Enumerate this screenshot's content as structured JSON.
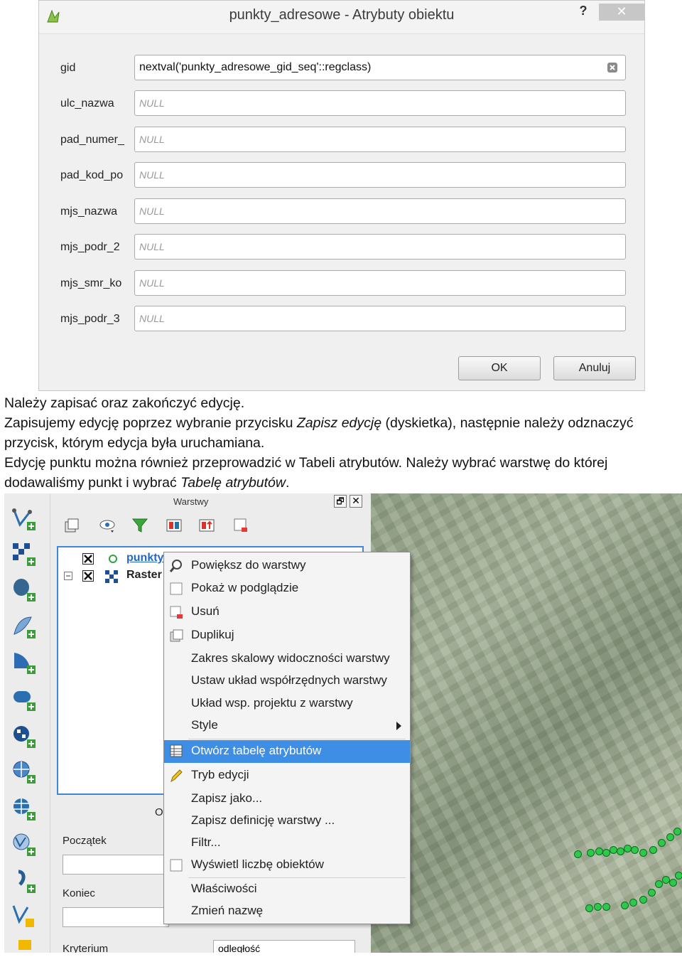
{
  "dialog": {
    "title": "punkty_adresowe - Atrybuty obiektu",
    "help": "?",
    "close": "✕",
    "fields": [
      {
        "label": "gid",
        "value": "nextval('punkty_adresowe_gid_seq'::regclass)"
      },
      {
        "label": "ulc_nazwa",
        "value": "NULL"
      },
      {
        "label": "pad_numer_",
        "value": "NULL"
      },
      {
        "label": "pad_kod_po",
        "value": "NULL"
      },
      {
        "label": "mjs_nazwa",
        "value": "NULL"
      },
      {
        "label": "mjs_podr_2",
        "value": "NULL"
      },
      {
        "label": "mjs_smr_ko",
        "value": "NULL"
      },
      {
        "label": "mjs_podr_3",
        "value": "NULL"
      }
    ],
    "ok_label": "OK",
    "cancel_label": "Anuluj"
  },
  "text": {
    "line1": "Należy zapisać oraz zakończyć edycję.",
    "line2a": "Zapisujemy edycję poprzez wybranie przycisku ",
    "line2b": "Zapisz edycję",
    "line2c": " (dyskietka), następnie należy odznaczyć",
    "line3": "przycisk, którym edycja była uruchamiana.",
    "line4": "Edycję punktu można również przeprowadzić w Tabeli atrybutów. Należy wybrać warstwę do której",
    "line5a": "dodawaliśmy punkt i wybrać ",
    "line5b": "Tabelę atrybutów",
    "line5c": "."
  },
  "layers_panel": {
    "title": "Warstwy",
    "float_btn": "🗗",
    "close_btn": "✕",
    "layers": [
      {
        "name": "punkty"
      },
      {
        "name": "Raster"
      }
    ],
    "label_start": "Początek",
    "label_end": "Koniec",
    "label_criterion": "Kryterium",
    "criterion_value": "odległość",
    "partial_o": "O"
  },
  "context_menu": {
    "items": [
      {
        "label": "Powiększ do warstwy",
        "icon": "zoom-icon"
      },
      {
        "label": "Pokaż w podglądzie",
        "icon": "checkbox-icon"
      },
      {
        "label": "Usuń",
        "icon": "remove-layer-icon"
      },
      {
        "label": "Duplikuj",
        "icon": "duplicate-icon"
      },
      {
        "label": "Zakres skalowy widoczności warstwy",
        "icon": ""
      },
      {
        "label": "Ustaw układ współrzędnych warstwy",
        "icon": ""
      },
      {
        "label": "Układ wsp. projektu z warstwy",
        "icon": ""
      },
      {
        "label": "Style",
        "icon": ""
      },
      {
        "label": "Otwórz tabelę atrybutów",
        "icon": "table-icon"
      },
      {
        "label": "Tryb edycji",
        "icon": "pencil-icon"
      },
      {
        "label": "Zapisz jako...",
        "icon": ""
      },
      {
        "label": "Zapisz definicję warstwy ...",
        "icon": ""
      },
      {
        "label": "Filtr...",
        "icon": ""
      },
      {
        "label": "Wyświetl liczbę obiektów",
        "icon": "checkbox-icon"
      },
      {
        "label": "Właściwości",
        "icon": ""
      },
      {
        "label": "Zmień nazwę",
        "icon": ""
      }
    ],
    "highlight_color": "#3d8ee4"
  }
}
